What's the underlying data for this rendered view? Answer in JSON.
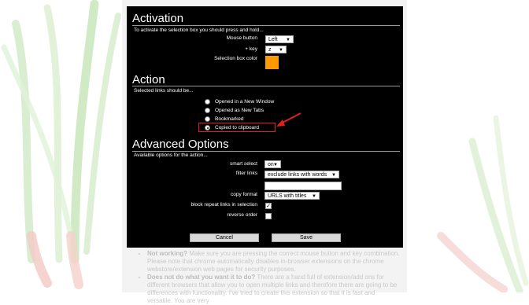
{
  "background_help": {
    "item1_label": "Not working?",
    "item1_text": " Make sure you are pressing the correct mouse button and key combination. Please note that chrome automatically disables in-browser extensions on the chrome webstore/extension web pages for security purposes.",
    "item2_label": "Does not do what you want it to do?",
    "item2_text": " There are a hand full of extension/add ons for different browsers that allow you to open multiple links and therefore there are going to be differences with functionality. I've tried to create this extension so that it is fast and versatile. You are very"
  },
  "activation": {
    "title": "Activation",
    "description": "To activate the selection box you should press and hold...",
    "mouse_button_label": "Mouse button",
    "mouse_button_value": "Left",
    "key_label": "+ key",
    "key_value": "z",
    "box_color_label": "Selection box color",
    "box_color": "#ff9900"
  },
  "action": {
    "title": "Action",
    "description": "Selected links should be...",
    "options": [
      "Opened in a New Window",
      "Opened as New Tabs",
      "Bookmarked",
      "Copied to clipboard"
    ],
    "selected_index": 3
  },
  "advanced": {
    "title": "Advanced Options",
    "description": "Available options for the action...",
    "smart_select_label": "smart select",
    "smart_select_value": "on",
    "filter_links_label": "filter links",
    "filter_links_value": "exclude links with words",
    "filter_words_value": "",
    "copy_format_label": "copy format",
    "copy_format_value": "URLS with titles",
    "block_repeat_label": "block repeat links in selection",
    "block_repeat_checked": true,
    "reverse_order_label": "reverse order",
    "reverse_order_checked": false
  },
  "buttons": {
    "cancel": "Cancel",
    "save": "Save"
  },
  "annotation_color": "#e02020"
}
